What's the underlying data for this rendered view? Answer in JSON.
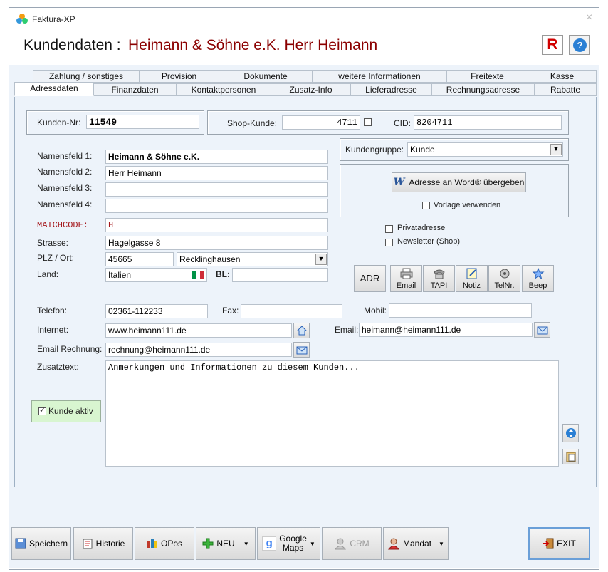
{
  "window": {
    "title": "Faktura-XP"
  },
  "header": {
    "title_prefix": "Kundendaten :",
    "title_name": "Heimann & Söhne e.K. Herr Heimann",
    "r_label": "R",
    "help_label": "?"
  },
  "tabs_row1": [
    "Zahlung / sonstiges",
    "Provision",
    "Dokumente",
    "weitere Informationen",
    "Freitexte",
    "Kasse"
  ],
  "tabs_row2": [
    "Adressdaten",
    "Finanzdaten",
    "Kontaktpersonen",
    "Zusatz-Info",
    "Lieferadresse",
    "Rechnungsadresse",
    "Rabatte"
  ],
  "customer": {
    "nr_label": "Kunden-Nr:",
    "nr": "11549",
    "shop_label": "Shop-Kunde:",
    "shop": "4711",
    "cid_label": "CID:",
    "cid": "8204711",
    "name1_label": "Namensfeld 1:",
    "name1": "Heimann & Söhne e.K.",
    "name2_label": "Namensfeld 2:",
    "name2": "Herr Heimann",
    "name3_label": "Namensfeld 3:",
    "name3": "",
    "name4_label": "Namensfeld 4:",
    "name4": "",
    "match_label": "MATCHCODE:",
    "match": "H",
    "street_label": "Strasse:",
    "street": "Hagelgasse 8",
    "plz_label": "PLZ / Ort:",
    "plz": "45665",
    "city": "Recklinghausen",
    "country_label": "Land:",
    "country": "Italien",
    "bl_label": "BL:",
    "bl": "",
    "group_label": "Kundengruppe:",
    "group": "Kunde",
    "word_btn": "Adresse an Word® übergeben",
    "vorlage": "Vorlage verwenden",
    "private": "Privatadresse",
    "newsletter": "Newsletter (Shop)",
    "phone_label": "Telefon:",
    "phone": "02361-112233",
    "fax_label": "Fax:",
    "fax": "",
    "mobile_label": "Mobil:",
    "mobile": "",
    "internet_label": "Internet:",
    "internet": "www.heimann111.de",
    "email_label": "Email:",
    "email": "heimann@heimann111.de",
    "email_inv_label": "Email Rechnung:",
    "email_inv": "rechnung@heimann111.de",
    "note_label": "Zusatztext:",
    "note": "Anmerkungen und Informationen zu diesem Kunden...",
    "active_label": "Kunde aktiv"
  },
  "actions": {
    "adr": "ADR",
    "email": "Email",
    "tapi": "TAPI",
    "notiz": "Notiz",
    "telnr": "TelNr.",
    "beep": "Beep"
  },
  "footer": {
    "save": "Speichern",
    "history": "Historie",
    "opos": "OPos",
    "new": "NEU",
    "maps1": "Google",
    "maps2": "Maps",
    "crm": "CRM",
    "mandat": "Mandat",
    "exit": "EXIT"
  },
  "colors": {
    "title_name": "#8b0000",
    "matchcode": "#a4161a",
    "active_bg": "#d8f5d0",
    "r_red": "#d10000",
    "help_blue": "#2a7fd4"
  }
}
